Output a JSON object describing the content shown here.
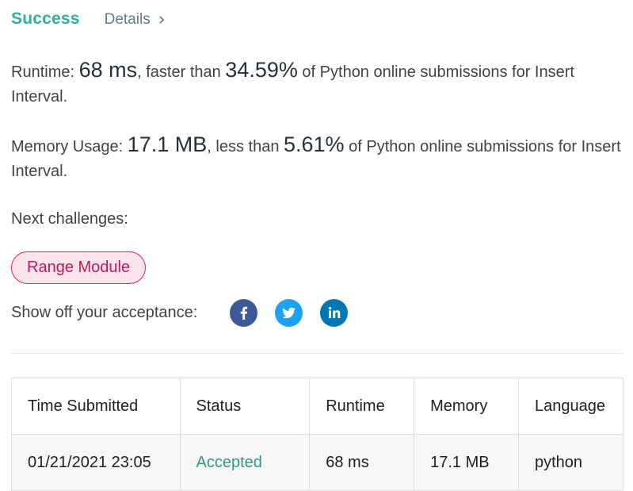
{
  "header": {
    "status": "Success",
    "details_label": "Details"
  },
  "runtime": {
    "label": "Runtime: ",
    "value": "68 ms",
    "mid": ", faster than ",
    "percent": "34.59%",
    "suffix": " of Python online submissions for Insert Interval."
  },
  "memory": {
    "label": "Memory Usage: ",
    "value": "17.1 MB",
    "mid": ", less than ",
    "percent": "5.61%",
    "suffix": " of Python online submissions for Insert Interval."
  },
  "next_challenges": {
    "label": "Next challenges:",
    "items": [
      "Range Module"
    ]
  },
  "share": {
    "label": "Show off your acceptance:",
    "icons": [
      "facebook-icon",
      "twitter-icon",
      "linkedin-icon"
    ]
  },
  "table": {
    "headers": [
      "Time Submitted",
      "Status",
      "Runtime",
      "Memory",
      "Language"
    ],
    "rows": [
      [
        "01/21/2021 23:05",
        "Accepted",
        "68 ms",
        "17.1 MB",
        "python"
      ]
    ]
  },
  "colors": {
    "success": "#2db09c",
    "accepted": "#2e9a83",
    "tag_border": "#e91e63",
    "tag_bg": "#fce4ec",
    "facebook": "#3b5998",
    "twitter": "#1da1f2",
    "linkedin": "#0077b5"
  }
}
